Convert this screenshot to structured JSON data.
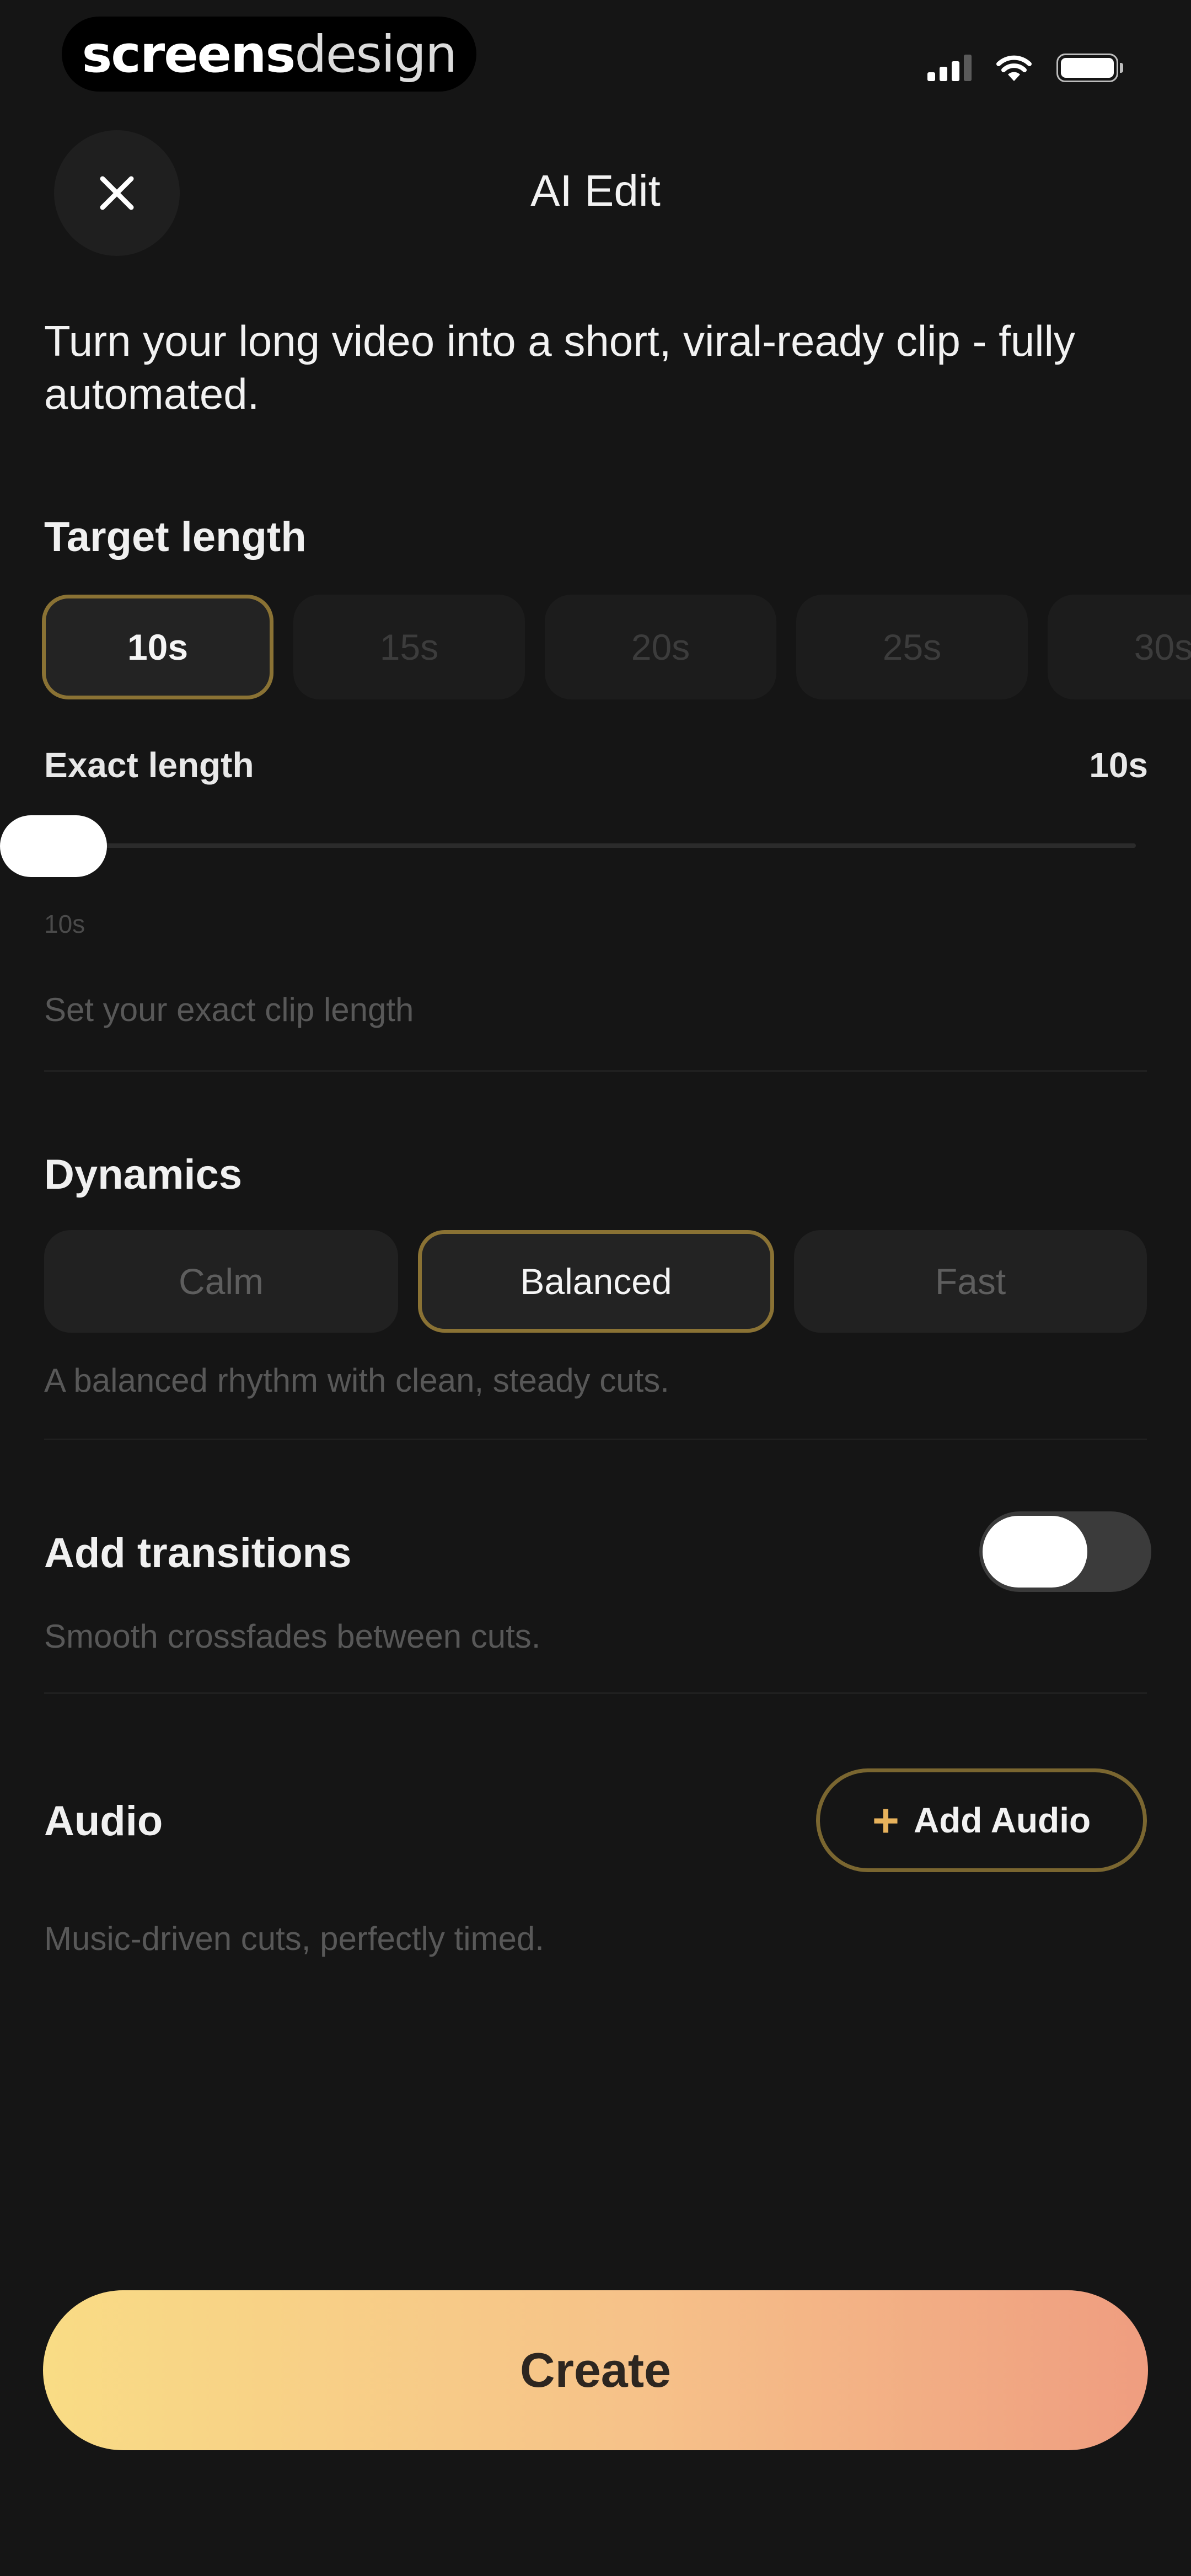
{
  "status_bar": {
    "brand_part1": "screens",
    "brand_part2": "design",
    "icons": [
      "signal-icon",
      "wifi-icon",
      "battery-icon"
    ]
  },
  "header": {
    "title": "AI Edit",
    "close_icon": "close-icon"
  },
  "intro": "Turn your long video into a short, viral-ready clip - fully automated.",
  "target_length": {
    "title": "Target length",
    "options": [
      "10s",
      "15s",
      "20s",
      "25s",
      "30s"
    ],
    "selected": "10s"
  },
  "exact_length": {
    "label": "Exact length",
    "value": "10s",
    "min_label": "10s",
    "slider_fraction": 0,
    "hint": "Set your exact clip length"
  },
  "dynamics": {
    "title": "Dynamics",
    "options": [
      "Calm",
      "Balanced",
      "Fast"
    ],
    "selected": "Balanced",
    "hint": "A balanced rhythm with clean, steady cuts."
  },
  "transitions": {
    "title": "Add transitions",
    "hint": "Smooth crossfades between cuts.",
    "enabled": false
  },
  "audio": {
    "title": "Audio",
    "button_label": "Add Audio",
    "hint": "Music-driven cuts, perfectly timed."
  },
  "create_label": "Create",
  "colors": {
    "background": "#151515",
    "accent_border": "#8a7234",
    "gradient_start": "#f9dc85",
    "gradient_end": "#ef9d80"
  }
}
